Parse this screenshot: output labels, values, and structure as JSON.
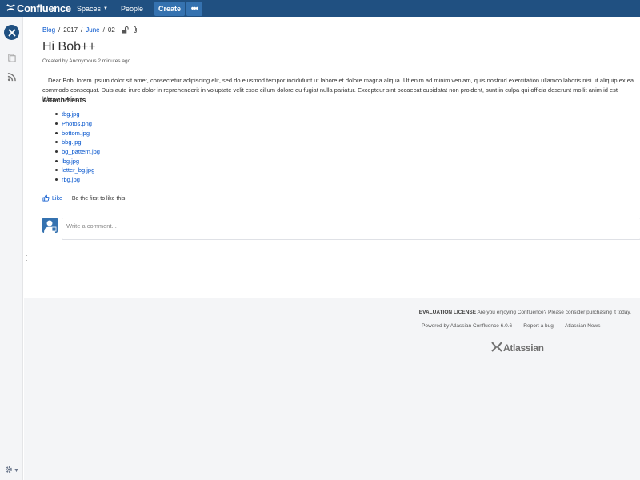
{
  "topbar": {
    "app_name": "Confluence",
    "nav": [
      {
        "label": "Spaces",
        "has_dropdown": true
      },
      {
        "label": "People",
        "has_dropdown": false
      }
    ],
    "create_label": "Create",
    "more_label": "•••"
  },
  "page": {
    "breadcrumb": [
      {
        "label": "Blog",
        "link": true
      },
      {
        "label": "2017",
        "link": false
      },
      {
        "label": "June",
        "link": true
      },
      {
        "label": "02",
        "link": false
      }
    ],
    "title": "Hi Bob++",
    "byline": "Created by Anonymous 2 minutes ago",
    "body": "Dear Bob, lorem ipsum dolor sit amet, consectetur adipiscing elit, sed do eiusmod tempor incididunt ut labore et dolore magna aliqua. Ut enim ad minim veniam, quis nostrud exercitation ullamco laboris nisi ut aliquip ex ea commodo consequat. Duis aute irure dolor in reprehenderit in voluptate velit esse cillum dolore eu fugiat nulla pariatur. Excepteur sint occaecat cupidatat non proident, sunt in culpa qui officia deserunt mollit anim id est laborum.Alice",
    "attachments_heading": "Attachments",
    "attachments": [
      "tbg.jpg",
      "Photos.png",
      "bottom.jpg",
      "bbg.jpg",
      "bg_pattern.jpg",
      "lbg.jpg",
      "letter_bg.jpg",
      "rbg.jpg"
    ],
    "like_label": "Like",
    "like_text": "Be the first to like this",
    "comment_placeholder": "Write a comment..."
  },
  "footer": {
    "license_label": "EVALUATION LICENSE",
    "license_text": "Are you enjoying Confluence? Please consider purchasing it today.",
    "powered_by": "Powered by Atlassian Confluence 6.0.6",
    "report_bug": "Report a bug",
    "atlassian_news": "Atlassian News",
    "brand": "Atlassian"
  },
  "colors": {
    "topbar": "#205081",
    "button": "#3572b0",
    "link": "#0052cc"
  },
  "icons": [
    "confluence-logo-icon",
    "chevron-down-icon",
    "space-logo-icon",
    "pages-icon",
    "rss-feed-icon",
    "gear-icon",
    "unlock-icon",
    "paperclip-icon",
    "thumbs-up-icon",
    "user-avatar-icon",
    "atlassian-logo-icon"
  ]
}
